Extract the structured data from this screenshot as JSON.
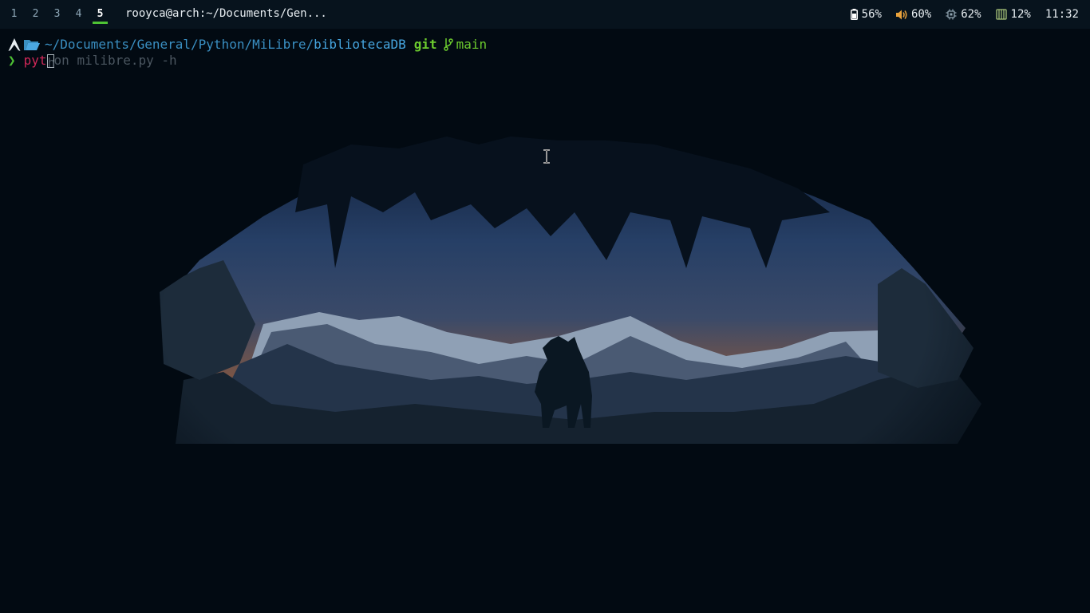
{
  "bar": {
    "workspaces": [
      {
        "label": "1",
        "active": false
      },
      {
        "label": "2",
        "active": false
      },
      {
        "label": "3",
        "active": false
      },
      {
        "label": "4",
        "active": false
      },
      {
        "label": "5",
        "active": true
      }
    ],
    "window_title": "rooyca@arch:~/Documents/Gen...",
    "battery": "56%",
    "volume": "60%",
    "cpu": "62%",
    "memory": "12%",
    "clock": "11:32"
  },
  "terminal": {
    "path": "~/Documents/General/Python/MiLibre/",
    "path_current": "bibliotecaDB",
    "git_label": "git",
    "branch": "main",
    "prompt_symbol": "❯",
    "command_typed": "pyt",
    "cursor_char": "h",
    "command_suggestion": "on milibre.py -h"
  },
  "colors": {
    "bar_bg": "#07131d",
    "accent_green": "#4ec334",
    "path_blue": "#3a8fc2",
    "command_red": "#d02858",
    "terminal_bg": "#020a12"
  }
}
